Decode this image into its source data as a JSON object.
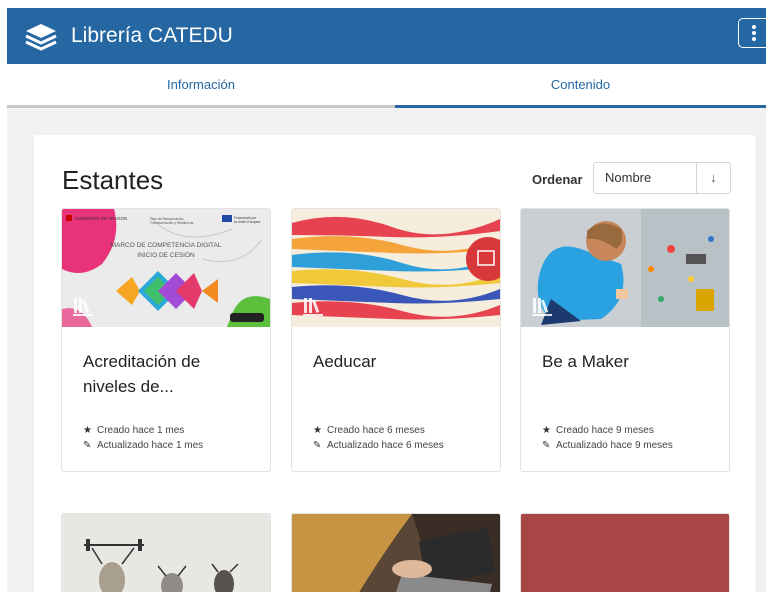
{
  "app": {
    "title": "Librería CATEDU",
    "logo_icon": "book-stack-icon",
    "menu_icon": "kebab-menu-icon"
  },
  "tabs": [
    {
      "label": "Información",
      "active": false
    },
    {
      "label": "Contenido",
      "active": true
    }
  ],
  "section": {
    "title": "Estantes"
  },
  "sort": {
    "label": "Ordenar",
    "value": "Nombre",
    "direction": "↓"
  },
  "shelves": [
    {
      "title": "Acreditación de niveles de...",
      "created": "Creado hace 1 mes",
      "updated": "Actualizado hace 1 mes",
      "image": {
        "logo_top_left": "GOBIERNO DE ARAGON",
        "logo_mid_line1": "Plan de Recuperación,",
        "logo_mid_line2": "Transformación y Resiliencia",
        "logo_right_line1": "Financiado por",
        "logo_right_line2": "la Unión Europea",
        "line1": "MARCO DE COMPETENCIA DIGITAL",
        "line2": "INICIO DE CESIÓN"
      }
    },
    {
      "title": "Aeducar",
      "created": "Creado hace 6 meses",
      "updated": "Actualizado hace 6 meses"
    },
    {
      "title": "Be a Maker",
      "created": "Creado hace 9 meses",
      "updated": "Actualizado hace 9 meses"
    }
  ],
  "icons": {
    "created": "star-icon",
    "updated": "pencil-icon",
    "shelf": "shelf-books-icon"
  },
  "colors": {
    "header": "#2567a3",
    "accent": "#2567a3",
    "page_bg": "#f2f2f2",
    "card4_bg": "#a84545"
  }
}
